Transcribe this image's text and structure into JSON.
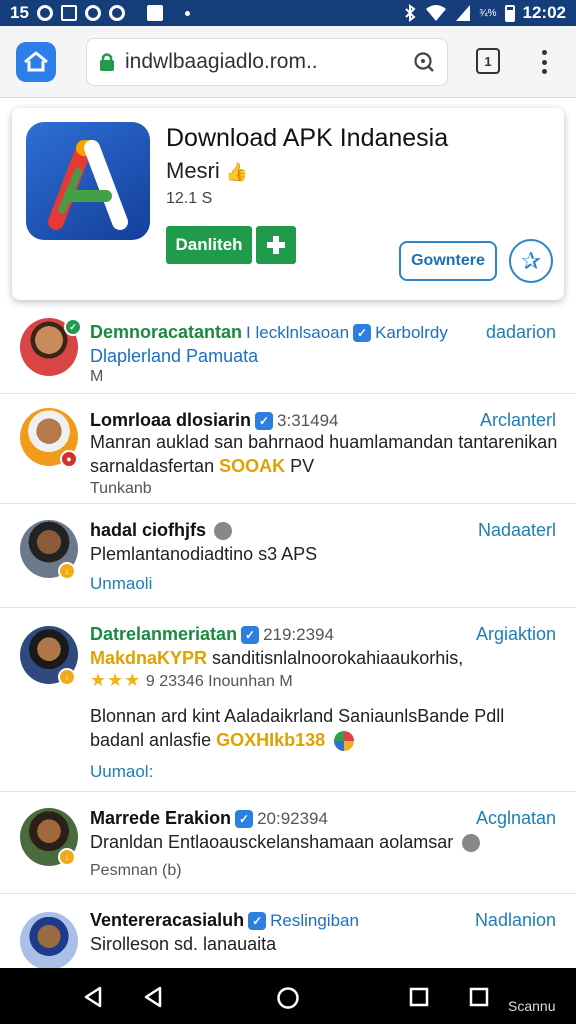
{
  "status_bar": {
    "left_text": "15",
    "time": "12:02",
    "battery_label": "¾%"
  },
  "browser": {
    "url": "indwlbaagiadlo.rom..",
    "tabs_count": "1"
  },
  "app": {
    "title": "Download APK Indanesia",
    "developer": "Mesri",
    "size": "12.1 S",
    "download_label": "Danliteh",
    "share_label": "Gowntere"
  },
  "comments": [
    {
      "name": "Demnoracatantan",
      "meta": "I lecklnlsaoan",
      "meta2": "Karbolrdy",
      "action": "dadarion",
      "line1": "Dlaplerland Pamuata",
      "line2": "M"
    },
    {
      "name": "Lomrloaa dlosiarin",
      "meta": "3:31494",
      "action": "Arclanterl",
      "line1": "Manran auklad san bahrnaod huamlamandan tantarenikan",
      "line2a": "sarnaldasfertan",
      "line2b": "SOOAK",
      "line2c": "PV",
      "small": "Tunkanb"
    },
    {
      "name": "hadal ciofhjfs",
      "action": "Nadaaterl",
      "line1": "Plemlantanodiadtino s3 APS",
      "link": "Unmaoli"
    },
    {
      "name": "Datrelanmeriatan",
      "meta": "219:2394",
      "action": "Argiaktion",
      "line1a": "MakdnaKYPR",
      "line1b": "sanditisnlalnoorokahiaaukorhis,",
      "rating_text": "9 23346 Inounhan M",
      "line2": "Blonnan ard kint  Aaladaikrland SaniaunlsBande Pdll",
      "line3a": "badanl anlasfie",
      "line3b": "GOXHIkb138",
      "link": "Uumaol:"
    },
    {
      "name": "Marrede Erakion",
      "meta": "20:92394",
      "action": "Acglnatan",
      "line1": "Dranldan Entlaoausckelanshamaan aolamsar",
      "small": "Pesmnan (b)"
    },
    {
      "name": "Ventereracasialuh",
      "meta": "Reslingiban",
      "action": "Nadlanion",
      "line1": "Sirolleson sd. lanauaita"
    }
  ],
  "nav": {
    "label": "Scannu"
  },
  "colors": {
    "status_bar": "#143d7a",
    "accent_blue": "#2d7ee8",
    "download_green": "#1f9b4b",
    "link_blue": "#1c7fb6"
  }
}
